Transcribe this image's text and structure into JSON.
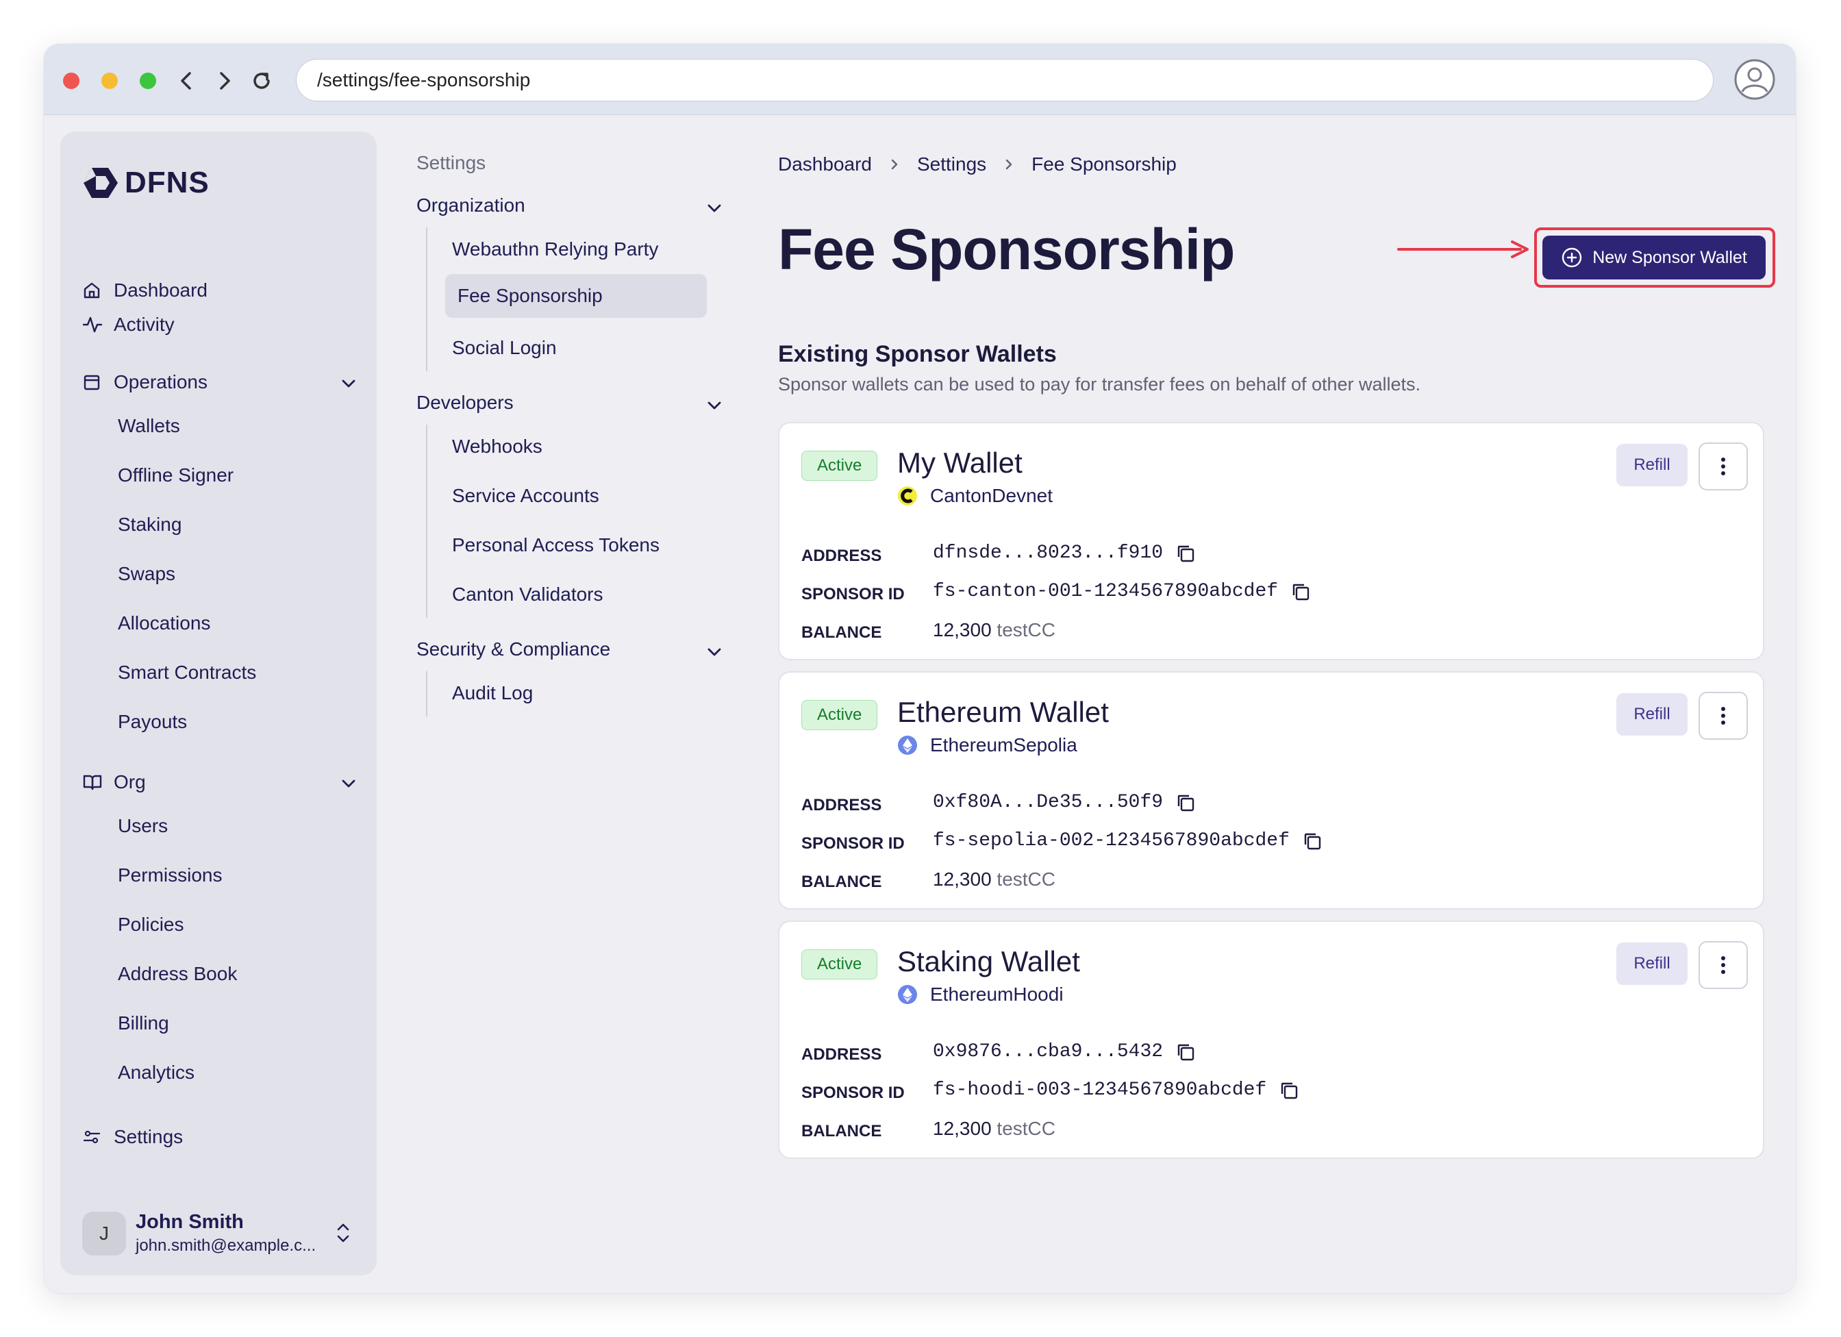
{
  "browser": {
    "url": "/settings/fee-sponsorship"
  },
  "sidebar": {
    "brand": "DFNS",
    "nav": [
      {
        "label": "Dashboard",
        "icon": "home-icon"
      },
      {
        "label": "Activity",
        "icon": "activity-icon"
      },
      {
        "label": "Operations",
        "icon": "operations-icon",
        "children": [
          "Wallets",
          "Offline Signer",
          "Staking",
          "Swaps",
          "Allocations",
          "Smart Contracts",
          "Payouts"
        ]
      },
      {
        "label": "Org",
        "icon": "book-icon",
        "children": [
          "Users",
          "Permissions",
          "Policies",
          "Address Book",
          "Billing",
          "Analytics"
        ]
      },
      {
        "label": "Settings",
        "icon": "sliders-icon"
      }
    ],
    "user": {
      "initial": "J",
      "name": "John Smith",
      "email": "john.smith@example.c..."
    }
  },
  "settings_nav": {
    "title": "Settings",
    "groups": [
      {
        "label": "Organization",
        "items": [
          "Webauthn Relying Party",
          "Fee Sponsorship",
          "Social Login"
        ]
      },
      {
        "label": "Developers",
        "items": [
          "Webhooks",
          "Service Accounts",
          "Personal Access Tokens",
          "Canton Validators"
        ]
      },
      {
        "label": "Security & Compliance",
        "items": [
          "Audit Log"
        ]
      }
    ],
    "active_item": "Fee Sponsorship"
  },
  "breadcrumb": [
    "Dashboard",
    "Settings",
    "Fee Sponsorship"
  ],
  "page": {
    "title": "Fee Sponsorship",
    "new_button": "New Sponsor Wallet",
    "section_title": "Existing Sponsor Wallets",
    "section_desc": "Sponsor wallets can be used to pay for transfer fees on behalf of other wallets."
  },
  "labels": {
    "address": "ADDRESS",
    "sponsor_id": "SPONSOR ID",
    "balance": "BALANCE",
    "refill": "Refill"
  },
  "wallets": [
    {
      "status": "Active",
      "name": "My Wallet",
      "network": "CantonDevnet",
      "network_icon": "canton-icon",
      "address": "dfnsde...8023...f910",
      "sponsor_id": "fs-canton-001-1234567890abcdef",
      "balance": "12,300",
      "unit": "testCC"
    },
    {
      "status": "Active",
      "name": "Ethereum Wallet",
      "network": "EthereumSepolia",
      "network_icon": "ethereum-icon",
      "address": "0xf80A...De35...50f9",
      "sponsor_id": "fs-sepolia-002-1234567890abcdef",
      "balance": "12,300",
      "unit": "testCC"
    },
    {
      "status": "Active",
      "name": "Staking Wallet",
      "network": "EthereumHoodi",
      "network_icon": "ethereum-icon",
      "address": "0x9876...cba9...5432",
      "sponsor_id": "fs-hoodi-003-1234567890abcdef",
      "balance": "12,300",
      "unit": "testCC"
    }
  ],
  "colors": {
    "primary": "#2e2475",
    "highlight": "#e5384a",
    "active_badge": "#d9f6dc"
  }
}
